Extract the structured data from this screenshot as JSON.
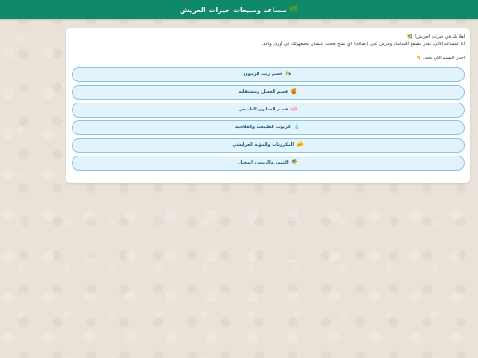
{
  "header": {
    "title": "مساعد ومبيعات خيرات العريش",
    "icon": "leaf-icon",
    "icon_glyph": "🌿"
  },
  "message": {
    "greeting": "أهلاً بك في خيرات العريش!",
    "greeting_icon_glyph": "🌿",
    "intro": "أنا المساعد الآلي، تقدر تتصفح أقسامنا، وتدرس على (إضافة) لاي منتج يعجبك علشان نجمعهولك في أوردر واحد.",
    "prompt": "اختار القسم اللي تحبه:",
    "prompt_icon_glyph": "👇"
  },
  "options": [
    {
      "label": "قسم زيت الزيتون",
      "icon": "olive-icon",
      "glyph": "🫒"
    },
    {
      "label": "قسم العسل ومشتقاته",
      "icon": "honey-jar-icon",
      "glyph": "🍯"
    },
    {
      "label": "قسم الصابون الطبيعي",
      "icon": "soap-icon",
      "glyph": "🧼"
    },
    {
      "label": "الزيوت الطبيعية والعلاجية",
      "icon": "oil-bottle-icon",
      "glyph": "🧴"
    },
    {
      "label": "المكرونات والمؤنة العرايشي",
      "icon": "cheese-icon",
      "glyph": "🧀"
    },
    {
      "label": "التمور والزيتون المخلل",
      "icon": "palm-tree-icon",
      "glyph": "🌴"
    }
  ],
  "colors": {
    "header_bg": "#0e8a6a",
    "option_bg": "#e3f3fc",
    "option_border": "#86c6e8",
    "option_text": "#1e5a7a"
  }
}
